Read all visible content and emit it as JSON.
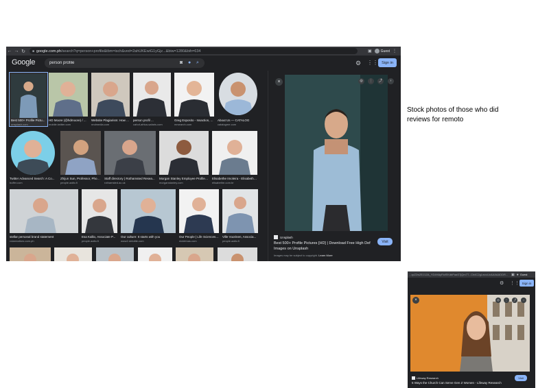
{
  "browser": {
    "url_host": "google.com.ph",
    "url_path": "/search?q=person+profile&tbm=isch&ved=2ahUKEwiG1yGjz...&biw=1280&bih=634",
    "profile_label": "Guest",
    "icons": {
      "back": "arrow-left-icon",
      "forward": "arrow-right-icon",
      "reload": "reload-icon",
      "lock": "lock-icon"
    }
  },
  "google": {
    "logo": "Google",
    "search_value": "person profile",
    "signin_label": "Sign in"
  },
  "results": [
    {
      "title": "Best 500+ Profile Pictu...",
      "source": "unsplash.com",
      "selected": true
    },
    {
      "title": "HD Moore (@hdmoore) / ...",
      "source": "mobile.twitter.com"
    },
    {
      "title": "Website Plagiarism: How ...",
      "source": "nndmedia.com"
    },
    {
      "title": "person profil ...",
      "source": "cahof-africa-safaris.com"
    },
    {
      "title": "Greg Esposito - Issaction, ...",
      "source": "mrsearch.com"
    },
    {
      "title": "About Us — CATALOG",
      "source": "catalogme.com"
    },
    {
      "title": "Twitter Advanced Search: A Co...",
      "source": "buffer.com"
    },
    {
      "title": "Zhijun Sun, Professor, Photo...",
      "source": "people.aalto.fi"
    },
    {
      "title": "Staff directory | Rothamsted Resea...",
      "source": "rothamsted.ac.uk"
    },
    {
      "title": "Morgan Stanley Employee Profiles ...",
      "source": "morganstanley.com"
    },
    {
      "title": "Elisabethe Imoleira - Elisabethe...",
      "source": "elisabethe.com.br"
    },
    {
      "title": "stellar personal brand statement",
      "source": "rolarrealtors.com.ph"
    },
    {
      "title": "Esa Kallio, Associate P...",
      "source": "people.aalto.fi"
    },
    {
      "title": "Our culture: It starts with you",
      "source": "www2.deloitte.com"
    },
    {
      "title": "Our People | Life Sciences ...",
      "source": "nicktrinas.com"
    },
    {
      "title": "Ville Vuorinen, Associa...",
      "source": "people.aalto.fi"
    }
  ],
  "panel": {
    "source_name": "Unsplash",
    "title": "Best 500+ Profile Pictures [HD] | Download Free High Def Images on Unsplash",
    "note": "Images may be subject to copyright.",
    "learn_more": "Learn More",
    "visit_label": "Visit",
    "icons": [
      "close-icon",
      "lens-icon",
      "more-icon",
      "share-icon",
      "chevron-right-icon"
    ]
  },
  "annotation": "Stock photos of those who did reviews for remoto",
  "browser2": {
    "url_fragment": "...qcZ2wZEJ1ZA_YD4HAyFlcfEKdbPaaS7jQm7T...Cb4C2gLwvcUcAAAAADDR...",
    "profile_label": "Guest",
    "signin_label": "Sign in",
    "source_name": "Lifeway Research",
    "title": "5 Ways the Church Can Serve Gen Z Women - Lifeway Research",
    "visit_label": "Visit"
  },
  "colors": {
    "page_bg": "#ffffff",
    "browser_bg": "#202124",
    "toolbar_bg": "#35363a",
    "search_bg": "#303134",
    "accent": "#8ab4f8",
    "text_primary": "#e8eaed",
    "text_secondary": "#9aa0a6"
  }
}
